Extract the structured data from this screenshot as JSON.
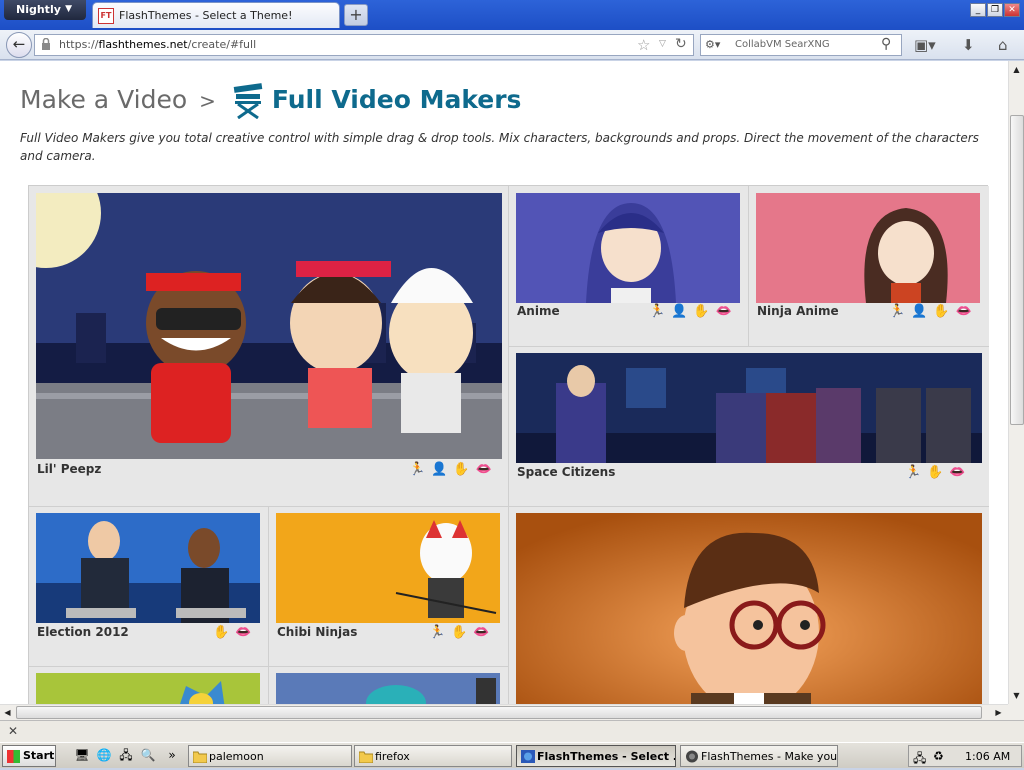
{
  "browser": {
    "app_menu": "Nightly",
    "tab_title": "FlashThemes - Select a Theme!",
    "tab_favicon": "FT",
    "new_tab": "+",
    "url_prefix": "https://",
    "url_domain": "flashthemes.net",
    "url_path": "/create/#full",
    "search_placeholder": "CollabVM SearXNG",
    "window_controls": [
      "minimize-icon",
      "restore-icon",
      "close-icon"
    ]
  },
  "page": {
    "breadcrumb_root": "Make a Video",
    "breadcrumb_sep": ">",
    "breadcrumb_current": "Full Video Makers",
    "description": "Full Video Makers give you total creative control with simple drag & drop tools. Mix characters, backgrounds and props. Direct the movement of the characters and camera."
  },
  "themes": [
    {
      "name": "Lil' Peepz",
      "features": [
        "walk-icon",
        "person-icon",
        "hand-icon",
        "lips-icon"
      ]
    },
    {
      "name": "Anime",
      "features": [
        "walk-icon",
        "person-icon",
        "hand-icon",
        "lips-icon"
      ]
    },
    {
      "name": "Ninja Anime",
      "features": [
        "walk-icon",
        "person-icon",
        "hand-icon",
        "lips-icon"
      ]
    },
    {
      "name": "Space Citizens",
      "features": [
        "walk-icon",
        "hand-icon",
        "lips-icon"
      ]
    },
    {
      "name": "Election 2012",
      "features": [
        "hand-icon",
        "lips-icon"
      ]
    },
    {
      "name": "Chibi Ninjas",
      "features": [
        "walk-icon",
        "hand-icon",
        "lips-icon"
      ]
    }
  ],
  "taskbar": {
    "start": "Start",
    "tasks": [
      "palemoon",
      "firefox",
      "FlashThemes - Select ...",
      "FlashThemes - Make your..."
    ],
    "clock": "1:06 AM"
  },
  "colors": {
    "accent": "#0e6a8d",
    "heading_gray": "#6a6a6a",
    "titlebar": "#2d63d8"
  }
}
